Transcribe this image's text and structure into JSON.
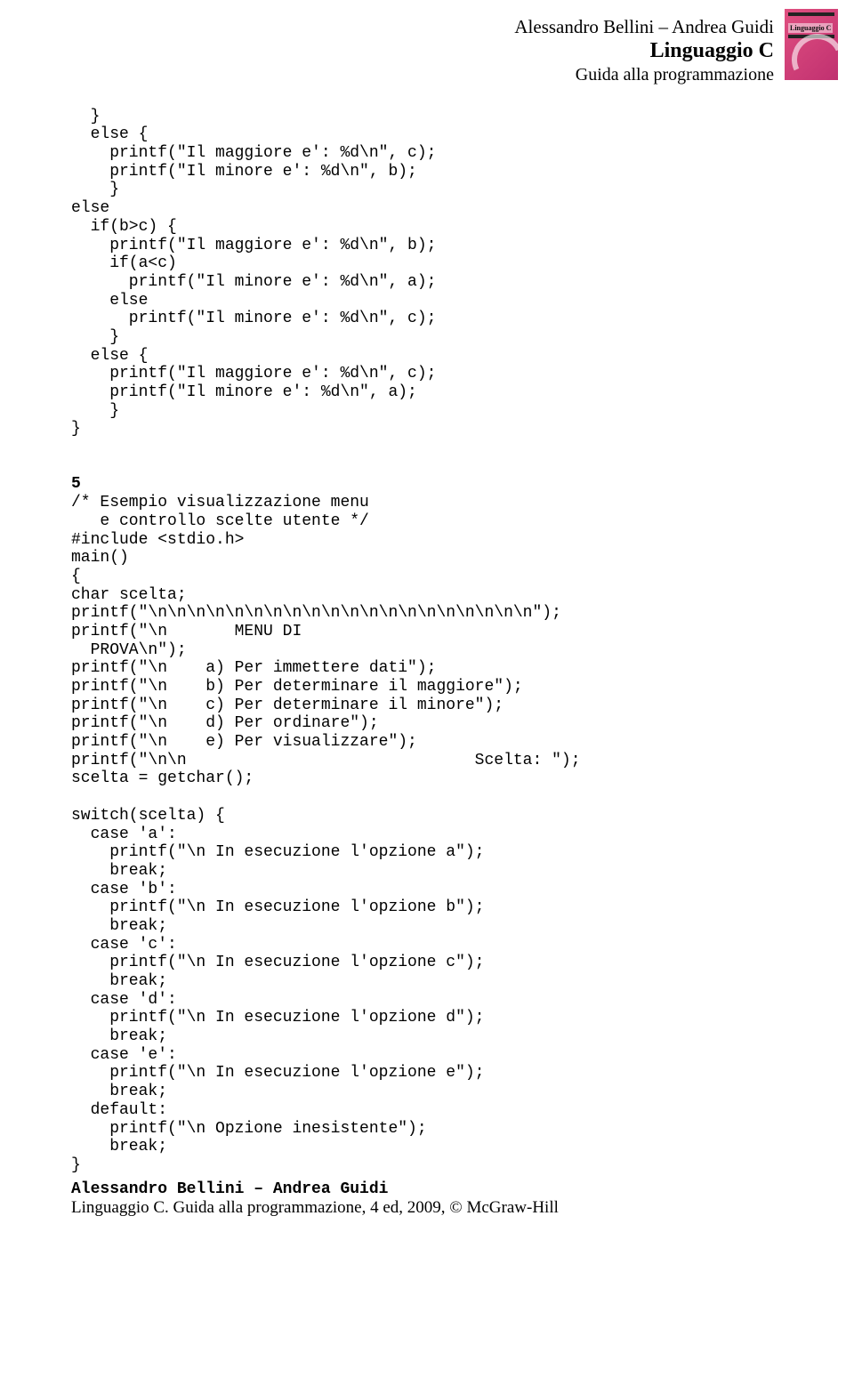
{
  "header": {
    "authors": "Alessandro Bellini – Andrea Guidi",
    "title": "Linguaggio C",
    "subtitle": "Guida alla programmazione",
    "cover_title": "Linguaggio C"
  },
  "code": {
    "block1_lines": [
      "  }",
      "  else {",
      "    printf(\"Il maggiore e': %d\\n\", c);",
      "    printf(\"Il minore e': %d\\n\", b);",
      "    }",
      "else",
      "  if(b>c) {",
      "    printf(\"Il maggiore e': %d\\n\", b);",
      "    if(a<c)",
      "      printf(\"Il minore e': %d\\n\", a);",
      "    else",
      "      printf(\"Il minore e': %d\\n\", c);",
      "    }",
      "  else {",
      "    printf(\"Il maggiore e': %d\\n\", c);",
      "    printf(\"Il minore e': %d\\n\", a);",
      "    }",
      "}"
    ],
    "ex_number": "5",
    "block2_lines": [
      "/* Esempio visualizzazione menu",
      "   e controllo scelte utente */",
      "#include <stdio.h>",
      "main()",
      "{",
      "char scelta;",
      "printf(\"\\n\\n\\n\\n\\n\\n\\n\\n\\n\\n\\n\\n\\n\\n\\n\\n\\n\\n\\n\\n\");",
      "printf(\"\\n       MENU DI",
      "  PROVA\\n\");",
      "printf(\"\\n    a) Per immettere dati\");",
      "printf(\"\\n    b) Per determinare il maggiore\");",
      "printf(\"\\n    c) Per determinare il minore\");",
      "printf(\"\\n    d) Per ordinare\");",
      "printf(\"\\n    e) Per visualizzare\");",
      "printf(\"\\n\\n                              Scelta: \");",
      "scelta = getchar();",
      "",
      "switch(scelta) {",
      "  case 'a':",
      "    printf(\"\\n In esecuzione l'opzione a\");",
      "    break;",
      "  case 'b':",
      "    printf(\"\\n In esecuzione l'opzione b\");",
      "    break;",
      "  case 'c':",
      "    printf(\"\\n In esecuzione l'opzione c\");",
      "    break;",
      "  case 'd':",
      "    printf(\"\\n In esecuzione l'opzione d\");",
      "    break;",
      "  case 'e':",
      "    printf(\"\\n In esecuzione l'opzione e\");",
      "    break;",
      "  default:",
      "    printf(\"\\n Opzione inesistente\");",
      "    break;",
      "}"
    ]
  },
  "footer": {
    "line1": "Alessandro Bellini – Andrea Guidi",
    "line2": "Linguaggio C. Guida alla programmazione, 4 ed, 2009, © McGraw-Hill"
  }
}
